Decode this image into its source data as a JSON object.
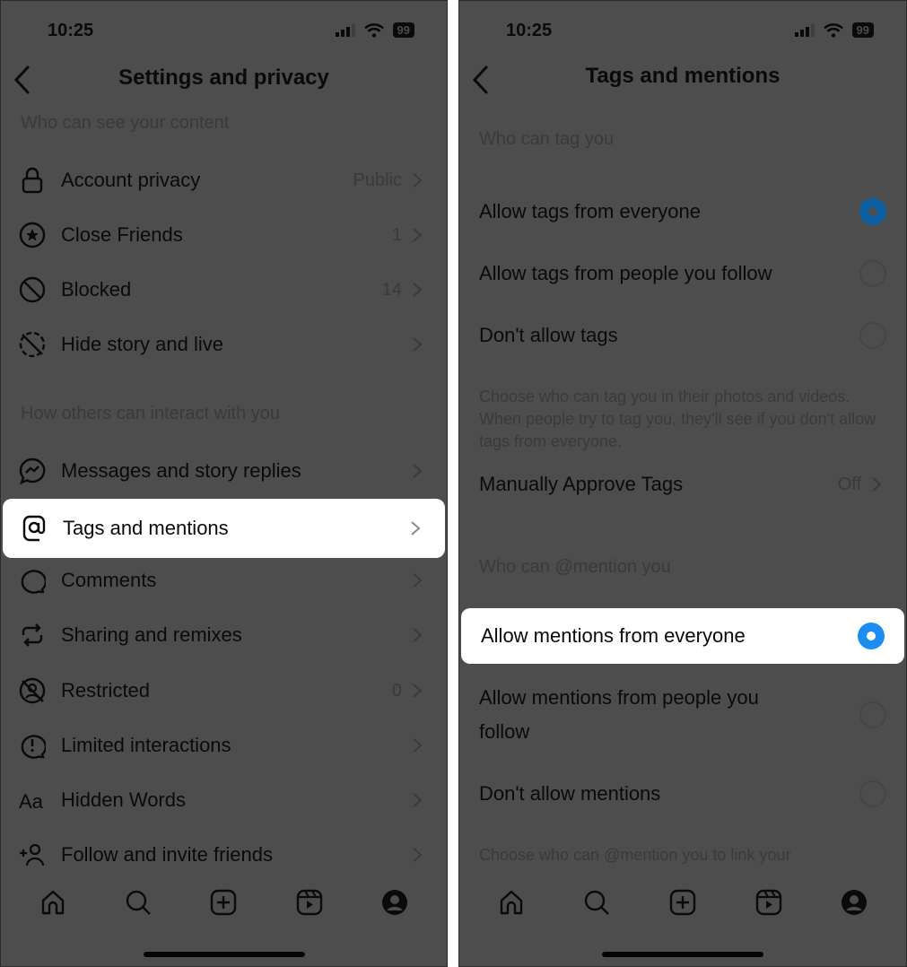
{
  "status_bar": {
    "time": "10:25",
    "battery": "99"
  },
  "left": {
    "title": "Settings and privacy",
    "sections": [
      {
        "header": "Who can see your content",
        "items": [
          {
            "label": "Account privacy",
            "value": "Public",
            "icon": "lock-icon"
          },
          {
            "label": "Close Friends",
            "value": "1",
            "icon": "star-circle-icon"
          },
          {
            "label": "Blocked",
            "value": "14",
            "icon": "block-icon"
          },
          {
            "label": "Hide story and live",
            "value": "",
            "icon": "hide-story-icon"
          }
        ]
      },
      {
        "header": "How others can interact with you",
        "items": [
          {
            "label": "Messages and story replies",
            "value": "",
            "icon": "messenger-icon"
          },
          {
            "label": "Tags and mentions",
            "value": "",
            "icon": "at-sign-icon",
            "highlighted": true
          },
          {
            "label": "Comments",
            "value": "",
            "icon": "comment-icon"
          },
          {
            "label": "Sharing and remixes",
            "value": "",
            "icon": "remix-icon"
          },
          {
            "label": "Restricted",
            "value": "0",
            "icon": "restricted-icon"
          },
          {
            "label": "Limited interactions",
            "value": "",
            "icon": "limited-icon"
          },
          {
            "label": "Hidden Words",
            "value": "",
            "icon": "text-aa-icon"
          },
          {
            "label": "Follow and invite friends",
            "value": "",
            "icon": "add-person-icon"
          }
        ]
      }
    ]
  },
  "right": {
    "title": "Tags and mentions",
    "tag_section": {
      "header": "Who can tag you",
      "options": [
        {
          "label": "Allow tags from everyone",
          "selected": true
        },
        {
          "label": "Allow tags from people you follow",
          "selected": false
        },
        {
          "label": "Don't allow tags",
          "selected": false
        }
      ],
      "helper": "Choose who can tag you in their photos and videos. When people try to tag you, they'll see if you don't allow tags from everyone.",
      "manual_approve": {
        "label": "Manually Approve Tags",
        "value": "Off"
      }
    },
    "mention_section": {
      "header": "Who can @mention you",
      "options": [
        {
          "label": "Allow mentions from everyone",
          "selected": true,
          "highlighted": true
        },
        {
          "label": "Allow mentions from people you follow",
          "selected": false
        },
        {
          "label": "Don't allow mentions",
          "selected": false
        }
      ],
      "helper": "Choose who can @mention you to link your"
    }
  },
  "tab_bar": [
    {
      "name": "home-tab",
      "icon": "home-icon"
    },
    {
      "name": "search-tab",
      "icon": "search-icon"
    },
    {
      "name": "create-tab",
      "icon": "plus-square-icon"
    },
    {
      "name": "reels-tab",
      "icon": "reels-icon"
    },
    {
      "name": "profile-tab",
      "icon": "profile-icon"
    }
  ],
  "colors": {
    "overlay_bg": "#4d4d4d",
    "radio_selected": "#1d8df0",
    "highlight_bg": "#ffffff"
  }
}
